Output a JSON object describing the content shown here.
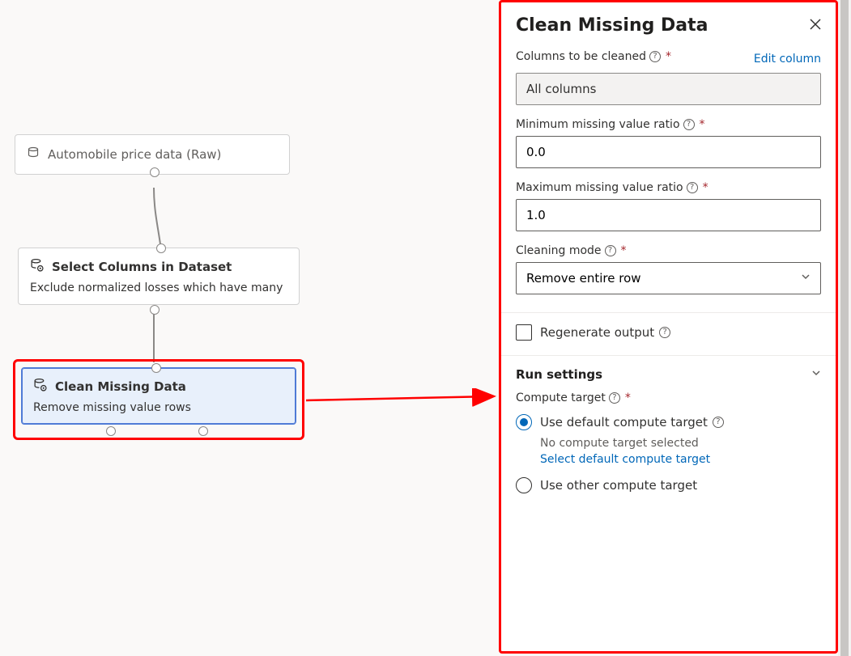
{
  "canvas": {
    "node1": {
      "title": "Automobile price data (Raw)"
    },
    "node2": {
      "title": "Select Columns in Dataset",
      "sub": "Exclude normalized losses which have many"
    },
    "node3": {
      "title": "Clean Missing Data",
      "sub": "Remove missing value rows"
    }
  },
  "panel": {
    "title": "Clean Missing Data",
    "columns_label": "Columns to be cleaned",
    "edit_link": "Edit column",
    "columns_value": "All columns",
    "min_label": "Minimum missing value ratio",
    "min_value": "0.0",
    "max_label": "Maximum missing value ratio",
    "max_value": "1.0",
    "mode_label": "Cleaning mode",
    "mode_value": "Remove entire row",
    "regen_label": "Regenerate output",
    "run_header": "Run settings",
    "compute_label": "Compute target",
    "radio1_label": "Use default compute target",
    "radio1_sub": "No compute target selected",
    "radio1_link": "Select default compute target",
    "radio2_label": "Use other compute target"
  }
}
